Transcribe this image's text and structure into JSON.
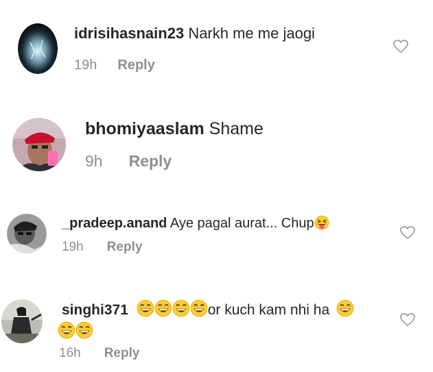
{
  "comments": [
    {
      "username": "idrisihasnain23",
      "text": "Narkh me me jaogi",
      "time": "19h",
      "reply_label": "Reply",
      "avatar_icon": "dark-profile-photo",
      "has_like": true
    },
    {
      "username": "bhomiyaaslam",
      "text": "Shame",
      "time": "9h",
      "reply_label": "Reply",
      "avatar_icon": "selfie-profile-photo",
      "has_like": false
    },
    {
      "username": "_pradeep.anand",
      "text": "Aye pagal aurat... Chup",
      "emoji": "squinting-tongue-emoji",
      "time": "19h",
      "reply_label": "Reply",
      "avatar_icon": "grayscale-profile-photo",
      "has_like": true
    },
    {
      "username": "singhi371",
      "text": "or kuch kam nhi ha",
      "emoji": "grinning-emoji",
      "emoji_count_before": 4,
      "emoji_count_after": 1,
      "emoji_count_line2": 2,
      "time": "16h",
      "reply_label": "Reply",
      "avatar_icon": "silhouette-profile-photo",
      "has_like": true
    }
  ],
  "colors": {
    "text": "#262626",
    "meta": "#8e8e8e",
    "emoji_face": "#ffcc33"
  },
  "like_icon": "heart-outline-icon"
}
